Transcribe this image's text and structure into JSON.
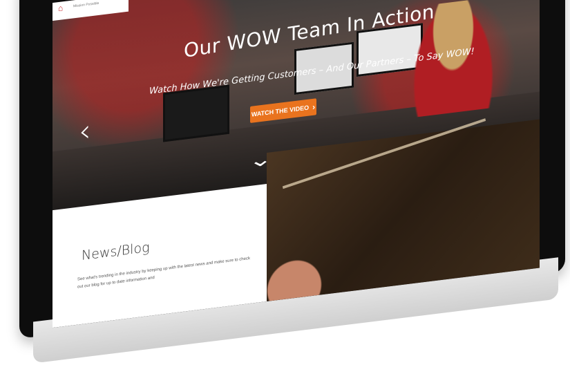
{
  "hero": {
    "title": "Our WOW Team In Action",
    "subtitle": "Watch How We're Getting Customers – And Our Partners – To Say WOW!",
    "cta_label": "WATCH THE VIDEO",
    "cta_icon": "chevron-right-icon",
    "next_icon": "chevron-right-icon",
    "prev_icon": "chevron-left-icon",
    "down_icon": "chevron-down-icon"
  },
  "header": {
    "home_icon": "home-icon",
    "logo_subtext": "Mission Possible"
  },
  "news": {
    "title": "News/Blog",
    "text": "See what's trending in the industry by keeping up with the latest news and make sure to check out our blog for up to date information and"
  },
  "colors": {
    "cta": "#e9731e",
    "brand_red": "#c62127"
  }
}
